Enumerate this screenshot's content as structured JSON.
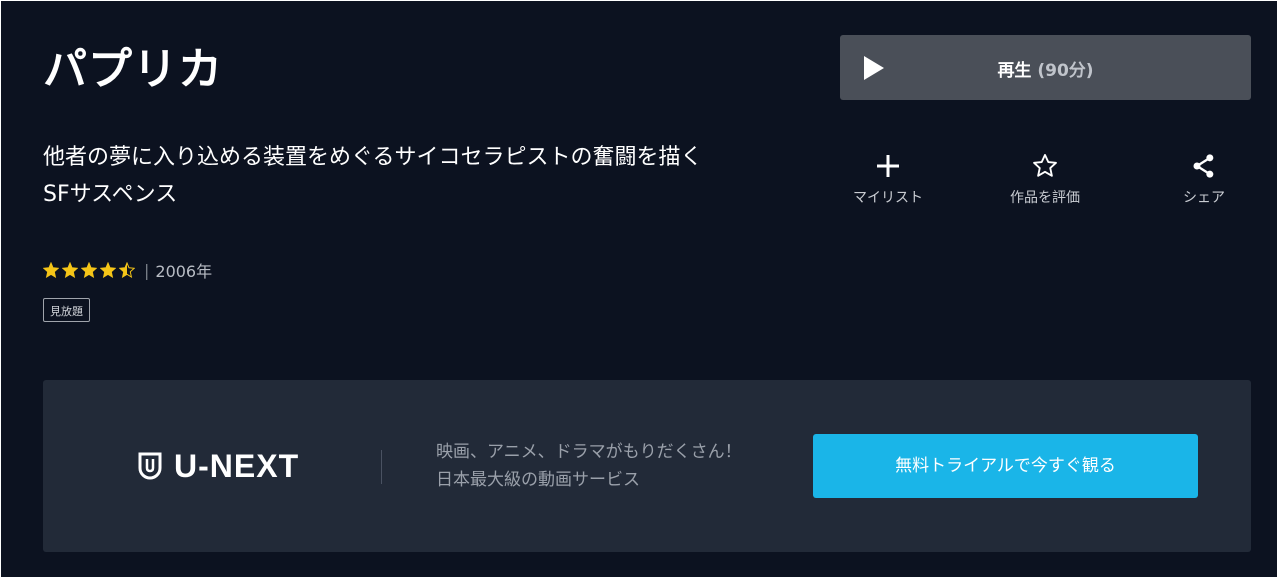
{
  "title": "パプリカ",
  "play": {
    "label": "再生",
    "duration": "(90分)"
  },
  "synopsis": "他者の夢に入り込める装置をめぐるサイコセラピストの奮闘を描くSFサスペンス",
  "actions": [
    {
      "label": "マイリスト",
      "icon": "plus-icon"
    },
    {
      "label": "作品を評価",
      "icon": "star-outline-icon"
    },
    {
      "label": "シェア",
      "icon": "share-icon"
    }
  ],
  "rating": {
    "stars": 4.5,
    "max": 5,
    "star_color": "#f5c518"
  },
  "year": "2006年",
  "badge": "見放題",
  "promo": {
    "logo_text": "U-NEXT",
    "copy_line1": "映画、アニメ、ドラマがもりだくさん！",
    "copy_line2": "日本最大級の動画サービス",
    "cta_label": "無料トライアルで今すぐ観る",
    "cta_color": "#1ab5e8"
  }
}
